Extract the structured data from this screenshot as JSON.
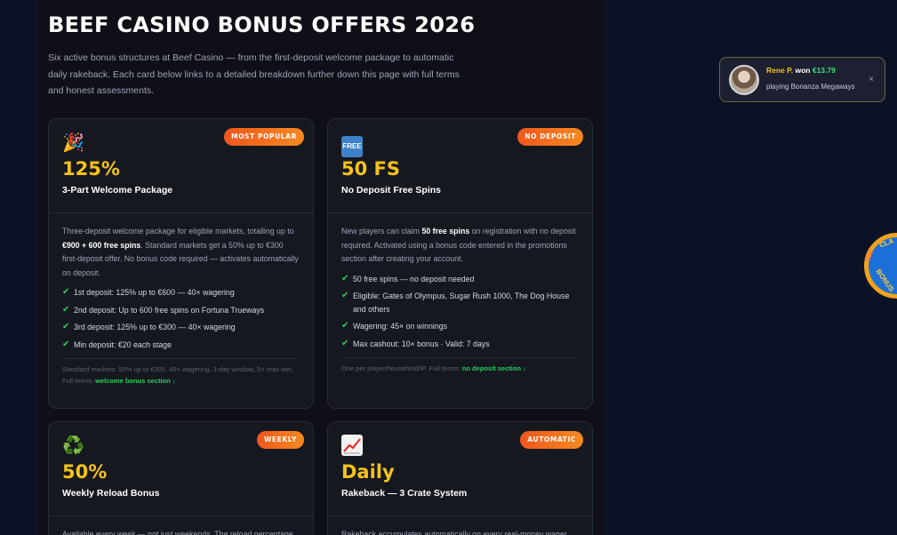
{
  "header": {
    "title": "BEEF CASINO BONUS OFFERS 2026",
    "intro": "Six active bonus structures at Beef Casino — from the first-deposit welcome package to automatic daily rakeback. Each card below links to a detailed breakdown further down this page with full terms and honest assessments."
  },
  "cards": [
    {
      "badge": "MOST POPULAR",
      "icon": "party-popper-icon",
      "emoji": "🎉",
      "headline": "125%",
      "subtitle": "3-Part Welcome Package",
      "desc_pre": "Three-deposit welcome package for eligible markets, totalling up to ",
      "desc_bold": "€900 + 600 free spins",
      "desc_post": ". Standard markets get a 50% up to €300 first-deposit offer. No bonus code required — activates automatically on deposit.",
      "checks": [
        "1st deposit: 125% up to €600 — 40× wagering",
        "2nd deposit: Up to 600 free spins on Fortuna Trueways",
        "3rd deposit: 125% up to €300 — 40× wagering",
        "Min deposit: €20 each stage"
      ],
      "foot_text": "Standard markets: 50% up to €300, 45× wagering, 3-day window, 5× max win. Full terms: ",
      "foot_link": "welcome bonus section ↓"
    },
    {
      "badge": "NO DEPOSIT",
      "icon": "free-icon",
      "emoji": "FREE",
      "headline": "50 FS",
      "subtitle": "No Deposit Free Spins",
      "desc_pre": "New players can claim ",
      "desc_bold": "50 free spins",
      "desc_post": " on registration with no deposit required. Activated using a bonus code entered in the promotions section after creating your account.",
      "checks": [
        "50 free spins — no deposit needed",
        "Eligible: Gates of Olympus, Sugar Rush 1000, The Dog House and others",
        "Wagering: 45× on winnings",
        "Max cashout: 10× bonus · Valid: 7 days"
      ],
      "foot_text": "One per player/household/IP. Full terms: ",
      "foot_link": "no deposit section ↓"
    },
    {
      "badge": "WEEKLY",
      "icon": "recycle-icon",
      "emoji": "♻️",
      "headline": "50%",
      "subtitle": "Weekly Reload Bonus",
      "desc_pre": "Available every week — not just weekends. The reload percentage",
      "desc_bold": "",
      "desc_post": ""
    },
    {
      "badge": "AUTOMATIC",
      "icon": "chart-up-icon",
      "emoji": "",
      "headline": "Daily",
      "subtitle": "Rakeback — 3 Crate System",
      "desc_pre": "Rakeback accumulates automatically on every real-money wager",
      "desc_bold": "",
      "desc_post": ""
    }
  ],
  "toast": {
    "name": "Rene P.",
    "won": "won",
    "amount": "€13.79",
    "game": "playing Bonanza Megaways",
    "close": "×"
  },
  "wheel": {
    "text_top": "CLA",
    "text_side": "$$$",
    "text_right": "BONUS"
  }
}
